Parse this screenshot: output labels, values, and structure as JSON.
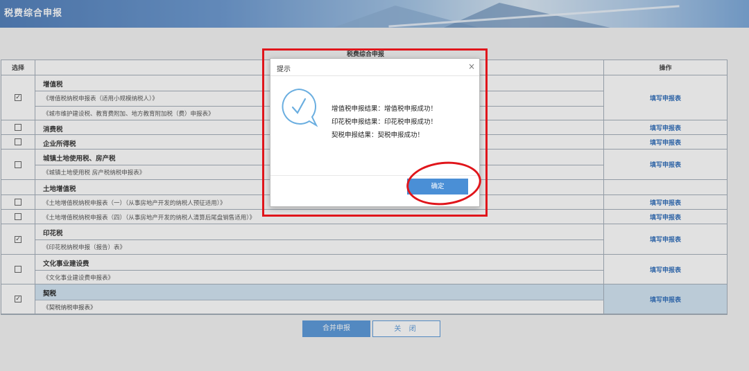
{
  "header": {
    "title": "税费综合申报"
  },
  "table": {
    "title": "税费综合申报",
    "col_select": "选择",
    "col_action": "操作",
    "rows": [
      {
        "title": "增值税",
        "checked": true,
        "action": "填写申报表",
        "subs": [
          "《增值税纳税申报表（适用小规模纳税人）》",
          "《城市维护建设税、教育费附加、地方教育附加税（费）申报表》"
        ]
      },
      {
        "title": "消费税",
        "checked": false,
        "action": "填写申报表",
        "subs": []
      },
      {
        "title": "企业所得税",
        "checked": false,
        "action": "填写申报表",
        "subs": []
      },
      {
        "title": "城镇土地使用税、房产税",
        "checked": false,
        "action": "填写申报表",
        "subs": [
          "《城镇土地使用税 房产税纳税申报表》"
        ]
      },
      {
        "title": "土地增值税",
        "checked": false,
        "action": "",
        "subs": []
      },
      {
        "title": "《土地增值税纳税申报表（一）（从事房地产开发的纳税人预征适用）》",
        "checked": false,
        "action": "填写申报表",
        "subs": []
      },
      {
        "title": "《土地增值税纳税申报表（四）（从事房地产开发的纳税人清算后尾盘销售适用）》",
        "checked": false,
        "action": "填写申报表",
        "subs": []
      },
      {
        "title": "印花税",
        "checked": true,
        "action": "填写申报表",
        "subs": [
          "《印花税纳税申报（报告）表》"
        ]
      },
      {
        "title": "文化事业建设费",
        "checked": false,
        "action": "填写申报表",
        "subs": [
          "《文化事业建设费申报表》"
        ]
      },
      {
        "title": "契税",
        "checked": true,
        "action": "填写申报表",
        "subs": [
          "《契税纳税申报表》"
        ]
      }
    ]
  },
  "buttons": {
    "merge": "合并申报",
    "close": "关 闭"
  },
  "dialog": {
    "title": "提示",
    "close_glyph": "×",
    "messages": [
      "增值税申报结果：增值税申报成功！",
      "印花税申报结果：印花税申报成功！",
      "契税申报结果：契税申报成功！"
    ],
    "ok": "确定"
  },
  "colors": {
    "accent": "#4a8fd6",
    "highlight_red": "#e0151b",
    "link": "#1a5fb4"
  }
}
